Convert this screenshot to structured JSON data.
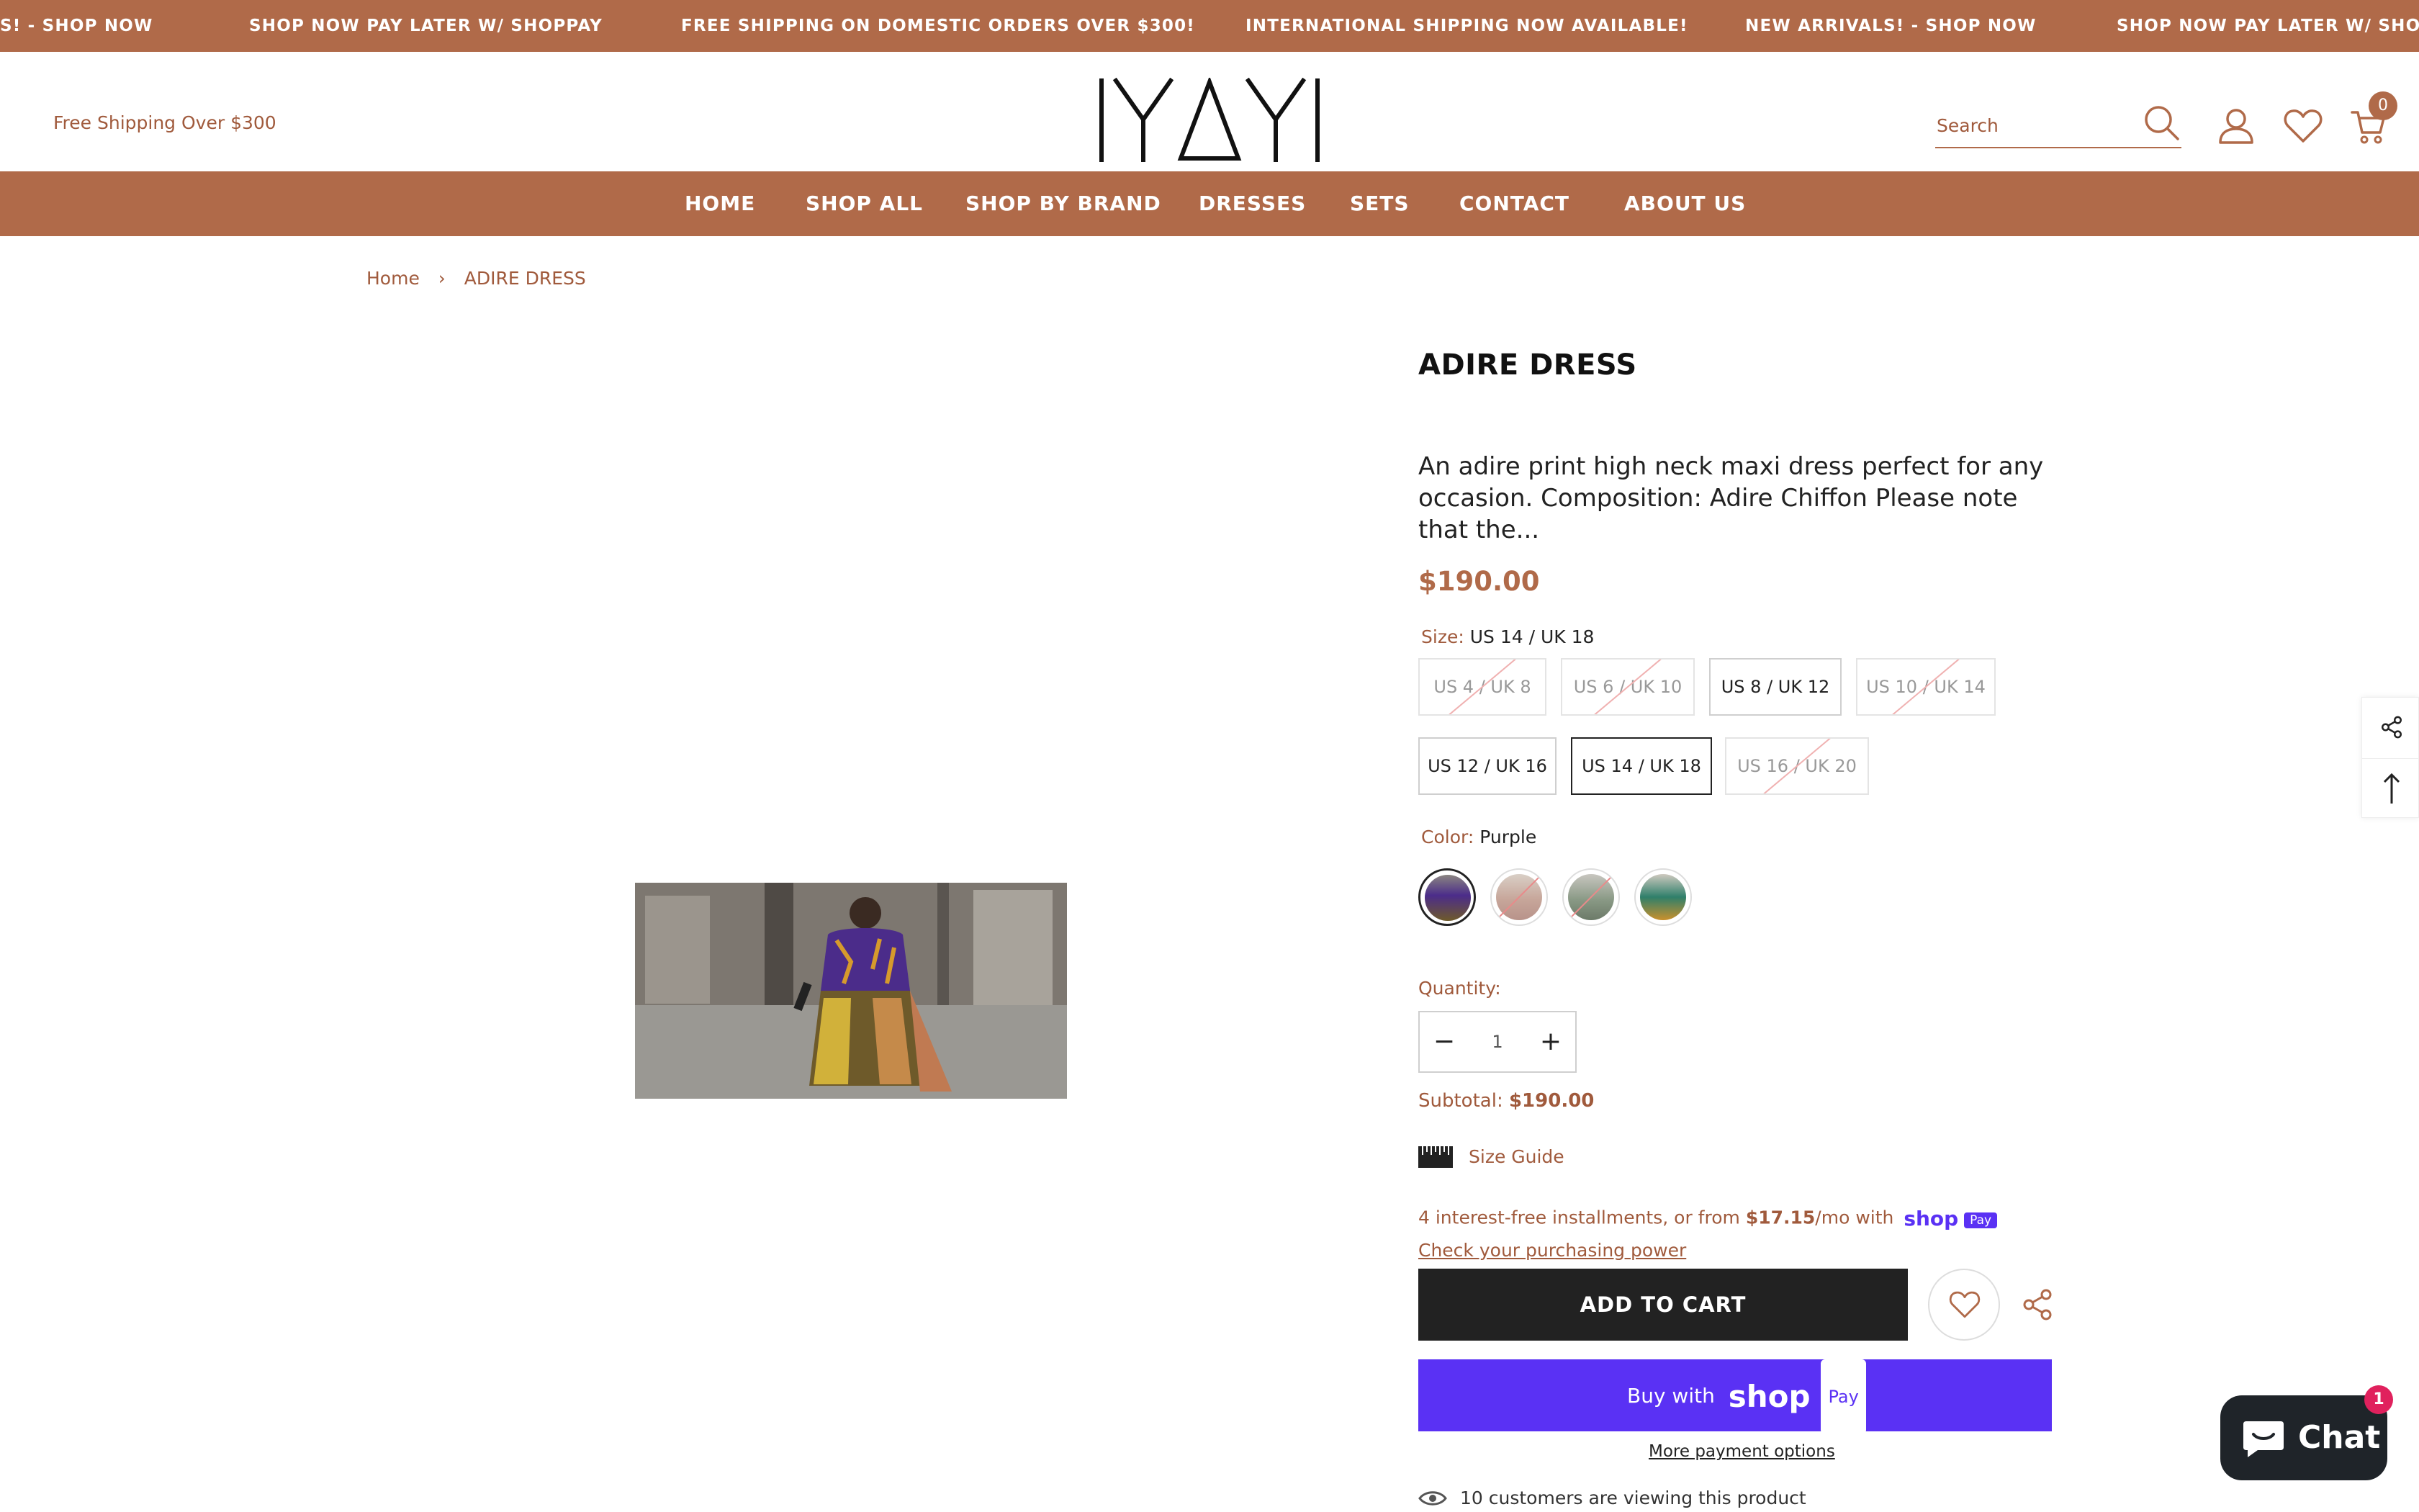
{
  "announcement": {
    "items": [
      "S! - SHOP NOW",
      "SHOP NOW PAY LATER W/ SHOPPAY",
      "FREE SHIPPING ON DOMESTIC ORDERS OVER $300!",
      "INTERNATIONAL SHIPPING NOW AVAILABLE!",
      "NEW ARRIVALS! - SHOP NOW",
      "SHOP NOW PAY LATER W/ SHOPP"
    ]
  },
  "header": {
    "free_shipping": "Free Shipping Over $300",
    "logo_text": "IYAYI",
    "search_placeholder": "Search",
    "cart_count": "0"
  },
  "nav": {
    "items": [
      "HOME",
      "SHOP ALL",
      "SHOP BY BRAND",
      "DRESSES",
      "SETS",
      "CONTACT",
      "ABOUT US"
    ]
  },
  "breadcrumb": {
    "home": "Home",
    "current": "ADIRE DRESS"
  },
  "product": {
    "title": "ADIRE DRESS",
    "description": "An adire print high neck maxi dress perfect for any occasion. Composition: Adire Chiffon Please note that the...",
    "price": "$190.00",
    "size_label": "Size:",
    "size_selected": "US 14 / UK 18",
    "sizes": [
      {
        "label": "US 4 / UK 8",
        "available": false
      },
      {
        "label": "US 6 / UK 10",
        "available": false
      },
      {
        "label": "US 8 / UK 12",
        "available": true
      },
      {
        "label": "US 10 / UK 14",
        "available": false
      },
      {
        "label": "US 12 / UK 16",
        "available": true
      },
      {
        "label": "US 14 / UK 18",
        "available": true,
        "selected": true
      },
      {
        "label": "US 16 / UK 20",
        "available": false
      }
    ],
    "color_label": "Color:",
    "color_selected": "Purple",
    "quantity_label": "Quantity:",
    "quantity": "1",
    "subtotal_label": "Subtotal:",
    "subtotal": "$190.00",
    "size_guide": "Size Guide",
    "installments_prefix": "4 interest-free installments, or from",
    "installments_amount": "$17.15",
    "installments_suffix": "/mo with",
    "shoppay_word": "shop",
    "shoppay_pay": "Pay",
    "check_power": "Check your purchasing power",
    "add_to_cart": "ADD TO CART",
    "buy_with": "Buy with",
    "more_payment": "More payment options",
    "viewing": "10 customers are viewing this product"
  },
  "chat": {
    "label": "Chat",
    "badge": "1"
  },
  "colors": {
    "brand": "#b06a49",
    "shop_pay": "#5a31f4",
    "dark": "#222222"
  }
}
